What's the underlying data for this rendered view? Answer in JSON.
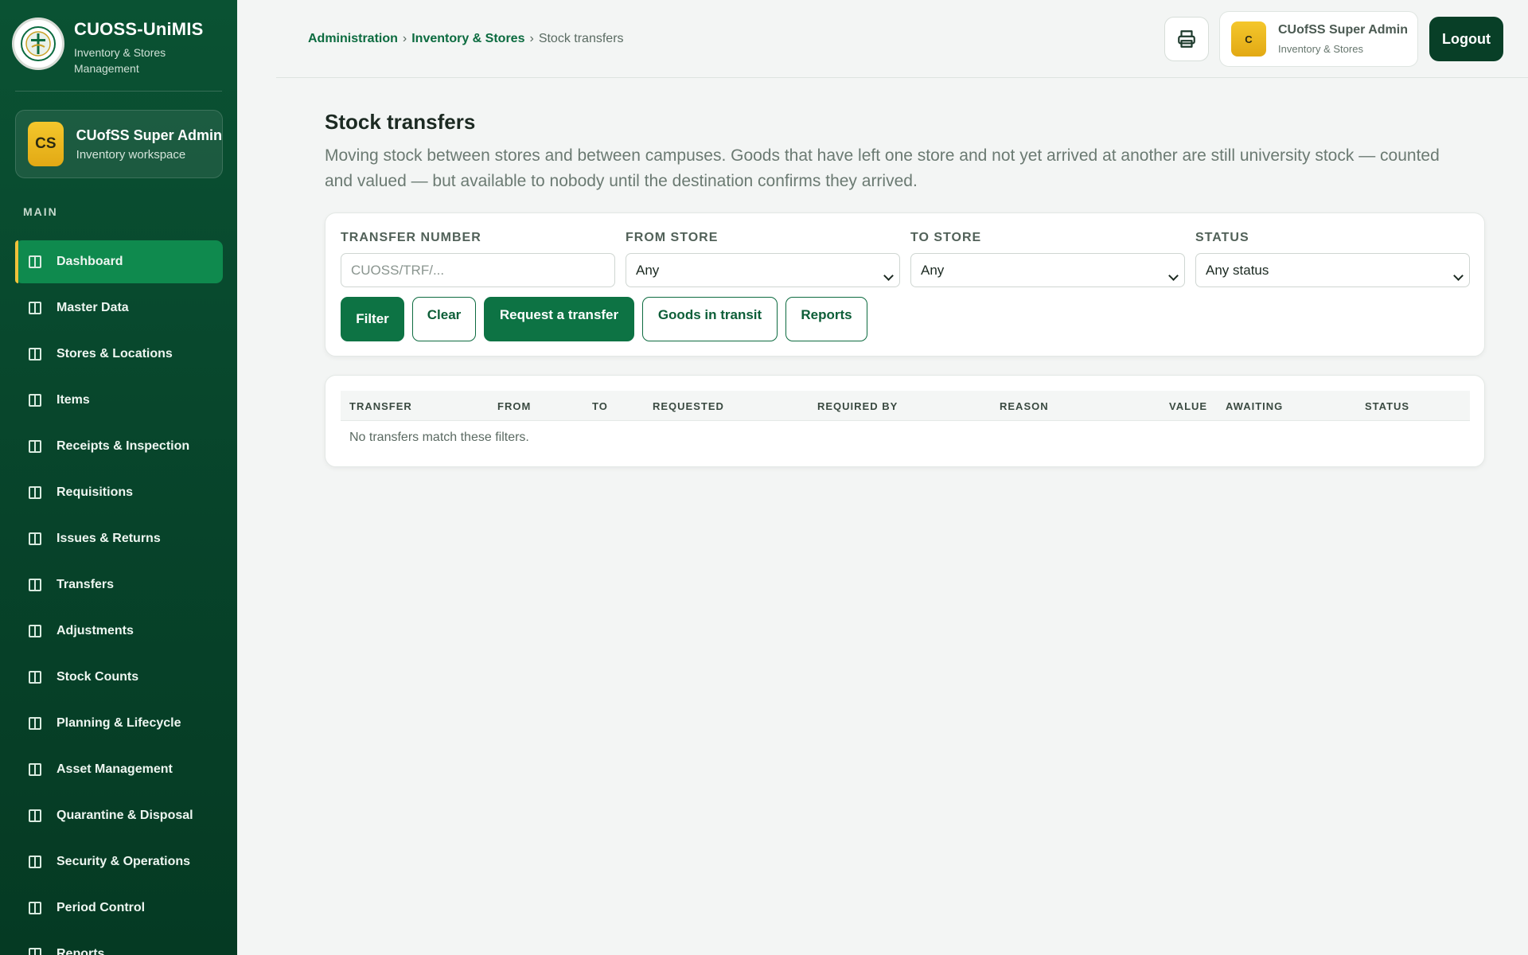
{
  "brand": {
    "title": "CUOSS-UniMIS",
    "subtitle": "Inventory & Stores Management"
  },
  "sidebar": {
    "user": {
      "initials": "CS",
      "name": "CUofSS Super Admin",
      "role": "Inventory workspace"
    },
    "section_label": "MAIN",
    "items": [
      {
        "label": "Dashboard",
        "active": true
      },
      {
        "label": "Master Data"
      },
      {
        "label": "Stores & Locations"
      },
      {
        "label": "Items"
      },
      {
        "label": "Receipts & Inspection"
      },
      {
        "label": "Requisitions"
      },
      {
        "label": "Issues & Returns"
      },
      {
        "label": "Transfers"
      },
      {
        "label": "Adjustments"
      },
      {
        "label": "Stock Counts"
      },
      {
        "label": "Planning & Lifecycle"
      },
      {
        "label": "Asset Management"
      },
      {
        "label": "Quarantine & Disposal"
      },
      {
        "label": "Security & Operations"
      },
      {
        "label": "Period Control"
      },
      {
        "label": "Reports"
      }
    ]
  },
  "topbar": {
    "breadcrumb": {
      "level1": "Administration",
      "level2": "Inventory & Stores",
      "current": "Stock transfers",
      "separator": "›"
    },
    "print_icon": "printer-icon",
    "user": {
      "initial": "C",
      "name": "CUofSS Super Admin",
      "role": "Inventory & Stores"
    },
    "logout_label": "Logout"
  },
  "page": {
    "title": "Stock transfers",
    "description": "Moving stock between stores and between campuses. Goods that have left one store and not yet arrived at another are still university stock — counted and valued — but available to nobody until the destination confirms they arrived."
  },
  "filters": {
    "transfer_number": {
      "label": "TRANSFER NUMBER",
      "placeholder": "CUOSS/TRF/...",
      "value": ""
    },
    "from_store": {
      "label": "FROM STORE",
      "selected": "Any"
    },
    "to_store": {
      "label": "TO STORE",
      "selected": "Any"
    },
    "status": {
      "label": "STATUS",
      "selected": "Any status"
    },
    "buttons": {
      "filter": "Filter",
      "clear": "Clear",
      "request": "Request a transfer",
      "transit": "Goods in transit",
      "reports": "Reports"
    }
  },
  "table": {
    "columns": [
      "TRANSFER",
      "FROM",
      "TO",
      "REQUESTED",
      "REQUIRED BY",
      "REASON",
      "VALUE",
      "AWAITING",
      "STATUS"
    ],
    "empty_message": "No transfers match these filters."
  },
  "colors": {
    "sidebar_bg": "#07432a",
    "accent_green": "#0d7344",
    "active_nav": "#0f8a4e",
    "gold": "#f0c23a",
    "logout_bg": "#083f27"
  }
}
